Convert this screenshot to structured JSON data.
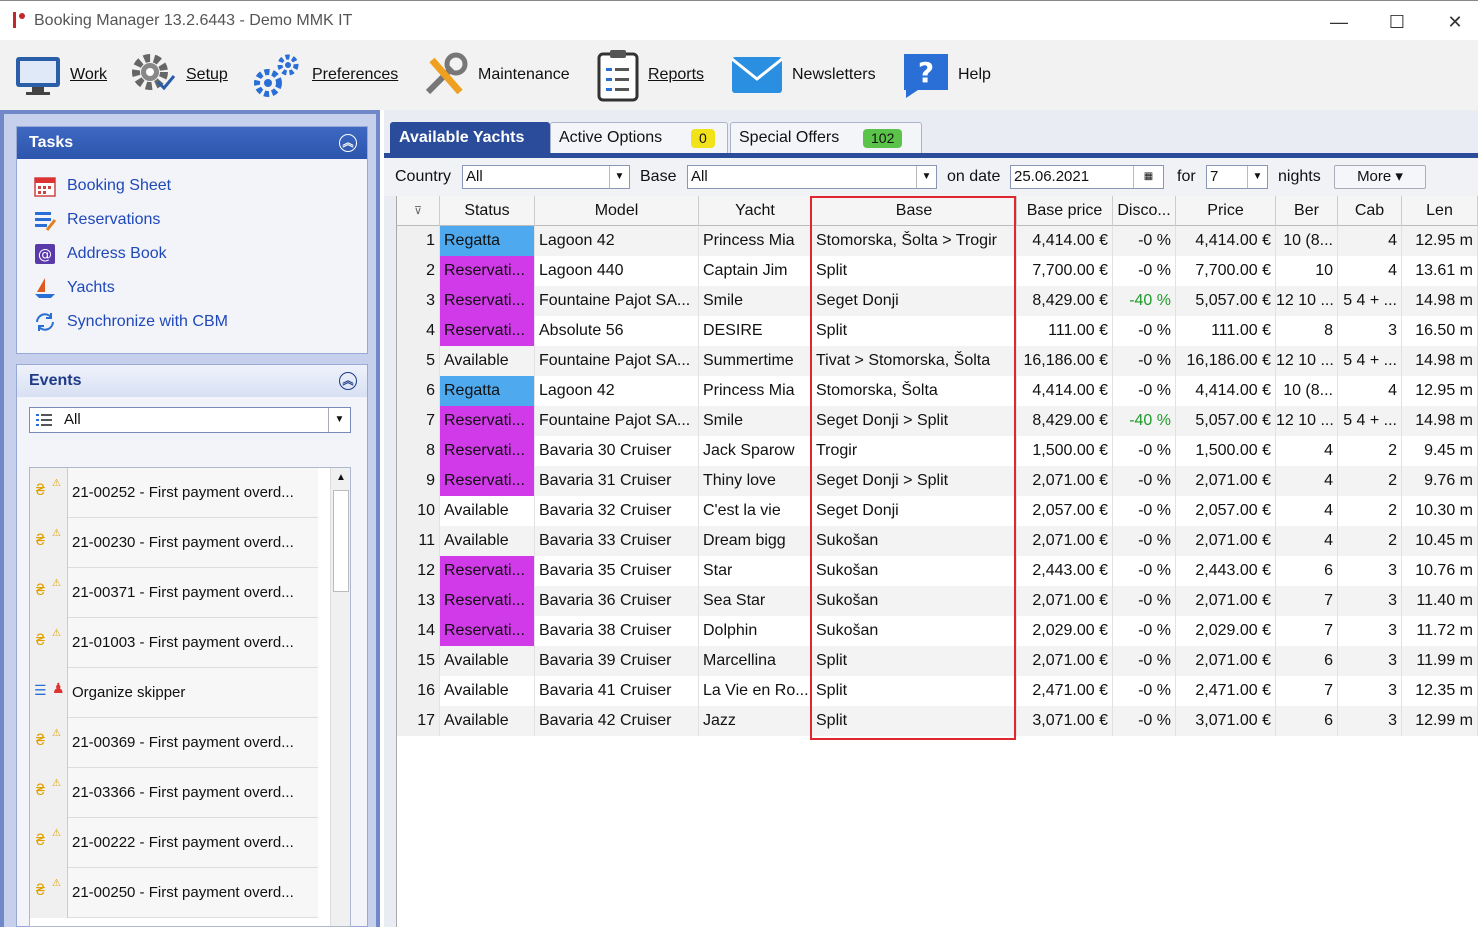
{
  "window": {
    "title": "Booking Manager 13.2.6443 - Demo MMK IT",
    "minimize": "—",
    "maximize": "☐",
    "close": "✕"
  },
  "toolbar": {
    "work": "Work",
    "setup": "Setup",
    "preferences": "Preferences",
    "maintenance": "Maintenance",
    "reports": "Reports",
    "newsletters": "Newsletters",
    "help": "Help"
  },
  "tasks": {
    "title": "Tasks",
    "items": [
      "Booking Sheet",
      "Reservations",
      "Address Book",
      "Yachts",
      "Synchronize with CBM"
    ]
  },
  "events": {
    "title": "Events",
    "filter": "All",
    "items": [
      "21-00252 - First payment overd...",
      "21-00230 - First payment overd...",
      "21-00371 - First payment overd...",
      "21-01003 - First payment overd...",
      "Organize skipper",
      "21-00369 - First payment overd...",
      "21-03366 - First payment overd...",
      "21-00222 - First payment overd...",
      "21-00250 - First payment overd..."
    ]
  },
  "tabs": {
    "available": "Available Yachts",
    "active_options": "Active Options",
    "active_options_count": "0",
    "special_offers": "Special Offers",
    "special_offers_count": "102"
  },
  "filters": {
    "country_label": "Country",
    "country_value": "All",
    "base_label": "Base",
    "base_value": "All",
    "date_label": "on date",
    "date_value": "25.06.2021",
    "for_label": "for",
    "nights_value": "7",
    "nights_label": "nights",
    "more": "More ▾"
  },
  "grid": {
    "headers": [
      "Status",
      "Model",
      "Yacht",
      "Base",
      "Base price",
      "Disco...",
      "Price",
      "Ber",
      "Cab",
      "Len"
    ],
    "rows": [
      {
        "n": "1",
        "status": "Regatta",
        "model": "Lagoon 42",
        "yacht": "Princess Mia",
        "base": "Stomorska, Šolta > Trogir",
        "base_price": "4,414.00 €",
        "disc": "-0 %",
        "price": "4,414.00 €",
        "ber": "10 (8...",
        "cab": "4",
        "len": "12.95 m"
      },
      {
        "n": "2",
        "status": "Reservati...",
        "model": "Lagoon 440",
        "yacht": "Captain Jim",
        "base": "Split",
        "base_price": "7,700.00 €",
        "disc": "-0 %",
        "price": "7,700.00 €",
        "ber": "10",
        "cab": "4",
        "len": "13.61 m"
      },
      {
        "n": "3",
        "status": "Reservati...",
        "model": "Fountaine Pajot SA...",
        "yacht": "Smile",
        "base": "Seget Donji",
        "base_price": "8,429.00 €",
        "disc": "-40 %",
        "price": "5,057.00 €",
        "ber": "12 10 ...",
        "cab": "5 4 + ...",
        "len": "14.98 m"
      },
      {
        "n": "4",
        "status": "Reservati...",
        "model": "Absolute 56",
        "yacht": "DESIRE",
        "base": "Split",
        "base_price": "111.00 €",
        "disc": "-0 %",
        "price": "111.00 €",
        "ber": "8",
        "cab": "3",
        "len": "16.50 m"
      },
      {
        "n": "5",
        "status": "Available",
        "model": "Fountaine Pajot SA...",
        "yacht": "Summertime",
        "base": "Tivat > Stomorska, Šolta",
        "base_price": "16,186.00 €",
        "disc": "-0 %",
        "price": "16,186.00 €",
        "ber": "12 10 ...",
        "cab": "5 4 + ...",
        "len": "14.98 m"
      },
      {
        "n": "6",
        "status": "Regatta",
        "model": "Lagoon 42",
        "yacht": "Princess Mia",
        "base": "Stomorska, Šolta",
        "base_price": "4,414.00 €",
        "disc": "-0 %",
        "price": "4,414.00 €",
        "ber": "10 (8...",
        "cab": "4",
        "len": "12.95 m"
      },
      {
        "n": "7",
        "status": "Reservati...",
        "model": "Fountaine Pajot SA...",
        "yacht": "Smile",
        "base": "Seget Donji > Split",
        "base_price": "8,429.00 €",
        "disc": "-40 %",
        "price": "5,057.00 €",
        "ber": "12 10 ...",
        "cab": "5 4 + ...",
        "len": "14.98 m"
      },
      {
        "n": "8",
        "status": "Reservati...",
        "model": "Bavaria 30 Cruiser",
        "yacht": "Jack Sparow",
        "base": "Trogir",
        "base_price": "1,500.00 €",
        "disc": "-0 %",
        "price": "1,500.00 €",
        "ber": "4",
        "cab": "2",
        "len": "9.45 m"
      },
      {
        "n": "9",
        "status": "Reservati...",
        "model": "Bavaria 31 Cruiser",
        "yacht": "Thiny love",
        "base": "Seget Donji > Split",
        "base_price": "2,071.00 €",
        "disc": "-0 %",
        "price": "2,071.00 €",
        "ber": "4",
        "cab": "2",
        "len": "9.76 m"
      },
      {
        "n": "10",
        "status": "Available",
        "model": "Bavaria 32 Cruiser",
        "yacht": "C'est la vie",
        "base": "Seget Donji",
        "base_price": "2,057.00 €",
        "disc": "-0 %",
        "price": "2,057.00 €",
        "ber": "4",
        "cab": "2",
        "len": "10.30 m"
      },
      {
        "n": "11",
        "status": "Available",
        "model": "Bavaria 33 Cruiser",
        "yacht": "Dream bigg",
        "base": "Sukošan",
        "base_price": "2,071.00 €",
        "disc": "-0 %",
        "price": "2,071.00 €",
        "ber": "4",
        "cab": "2",
        "len": "10.45 m"
      },
      {
        "n": "12",
        "status": "Reservati...",
        "model": "Bavaria 35 Cruiser",
        "yacht": "Star",
        "base": "Sukošan",
        "base_price": "2,443.00 €",
        "disc": "-0 %",
        "price": "2,443.00 €",
        "ber": "6",
        "cab": "3",
        "len": "10.76 m"
      },
      {
        "n": "13",
        "status": "Reservati...",
        "model": "Bavaria 36 Cruiser",
        "yacht": "Sea Star",
        "base": "Sukošan",
        "base_price": "2,071.00 €",
        "disc": "-0 %",
        "price": "2,071.00 €",
        "ber": "7",
        "cab": "3",
        "len": "11.40 m"
      },
      {
        "n": "14",
        "status": "Reservati...",
        "model": "Bavaria 38 Cruiser",
        "yacht": "Dolphin",
        "base": "Sukošan",
        "base_price": "2,029.00 €",
        "disc": "-0 %",
        "price": "2,029.00 €",
        "ber": "7",
        "cab": "3",
        "len": "11.72 m"
      },
      {
        "n": "15",
        "status": "Available",
        "model": "Bavaria 39 Cruiser",
        "yacht": "Marcellina",
        "base": "Split",
        "base_price": "2,071.00 €",
        "disc": "-0 %",
        "price": "2,071.00 €",
        "ber": "6",
        "cab": "3",
        "len": "11.99 m"
      },
      {
        "n": "16",
        "status": "Available",
        "model": "Bavaria 41 Cruiser",
        "yacht": "La Vie en Ro...",
        "base": "Split",
        "base_price": "2,471.00 €",
        "disc": "-0 %",
        "price": "2,471.00 €",
        "ber": "7",
        "cab": "3",
        "len": "12.35 m"
      },
      {
        "n": "17",
        "status": "Available",
        "model": "Bavaria 42 Cruiser",
        "yacht": "Jazz",
        "base": "Split",
        "base_price": "3,071.00 €",
        "disc": "-0 %",
        "price": "3,071.00 €",
        "ber": "6",
        "cab": "3",
        "len": "12.99 m"
      }
    ]
  },
  "colors": {
    "regatta": "#4ea9ef",
    "reservation": "#d13ae8",
    "accent": "#2a4c9a",
    "highlight": "#e0262e"
  }
}
